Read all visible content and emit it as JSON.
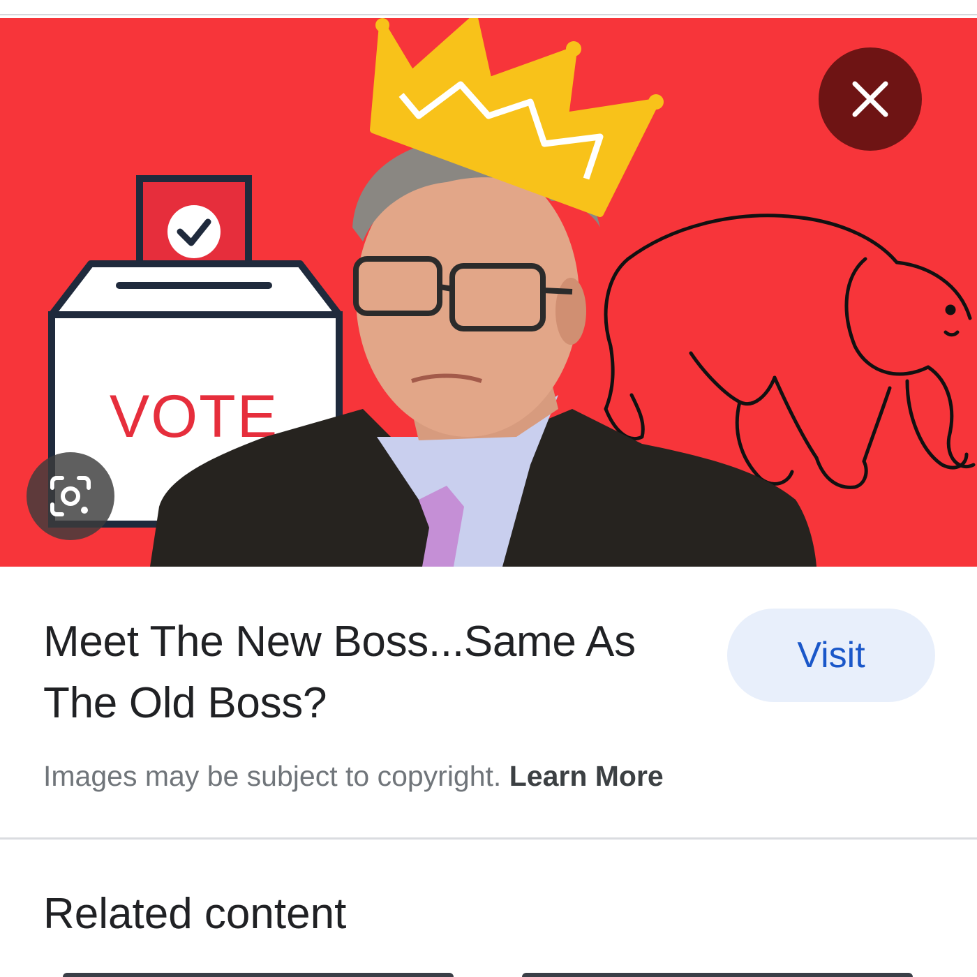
{
  "hero": {
    "box_label": "VOTE",
    "colors": {
      "background": "#f7353a",
      "ballot_red": "#e62e3c",
      "outline": "#1f2a3c",
      "crown": "#f8c21a",
      "suit": "#26231f",
      "shirt": "#c9cfee",
      "tie": "#c58fd6"
    },
    "close_icon": "close-icon",
    "lens_icon": "lens-icon"
  },
  "result": {
    "title_line1": "Meet The New Boss...Same As",
    "title_line2": "The Old Boss?",
    "visit_label": "Visit",
    "accent": "#1a57c9"
  },
  "notice": {
    "text": "Images may be subject to copyright.",
    "link": "Learn More"
  },
  "related": {
    "heading": "Related content"
  }
}
